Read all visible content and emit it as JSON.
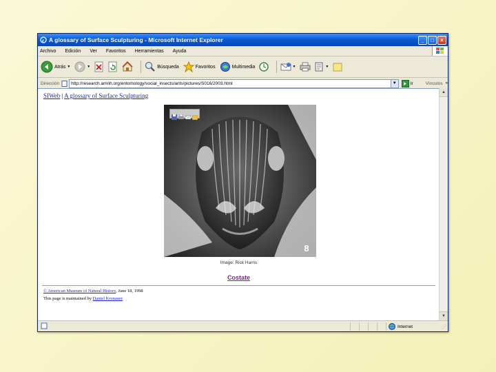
{
  "window": {
    "title": "A glossary of Surface Sculpturing - Microsoft Internet Explorer",
    "min": "_",
    "max": "□",
    "close": "×"
  },
  "menu": [
    "Archivo",
    "Edición",
    "Ver",
    "Favoritos",
    "Herramientas",
    "Ayuda"
  ],
  "toolbar": {
    "back": "Atrás",
    "search": "Búsqueda",
    "favorites": "Favoritos",
    "multimedia": "Multimedia"
  },
  "address": {
    "label": "Dirección",
    "url": "http://research.amnh.org/entomology/social_insects/ants/pictures/S016/2003.html",
    "go": "Ir",
    "links": "Vínculos"
  },
  "content": {
    "crumb_home": "SIWeb",
    "crumb_sep": " | ",
    "crumb_page": "A glossary of Surface Sculpturing",
    "image_number": "8",
    "credit": "Image: Rick Harris",
    "term": "Costate",
    "footer_owner": "© American Museum of Natural History",
    "footer_date": ", June 18, 1998",
    "footer_prefix": "This page is maintained by ",
    "footer_maintainer": "Daniel Kronauer"
  },
  "status": {
    "zone": "Internet"
  },
  "colors": {
    "link": "#1c1cc8",
    "visited": "#8a1a9a",
    "titlebar": "#0a5ad8",
    "slide_bg": "#f6f3c4"
  }
}
